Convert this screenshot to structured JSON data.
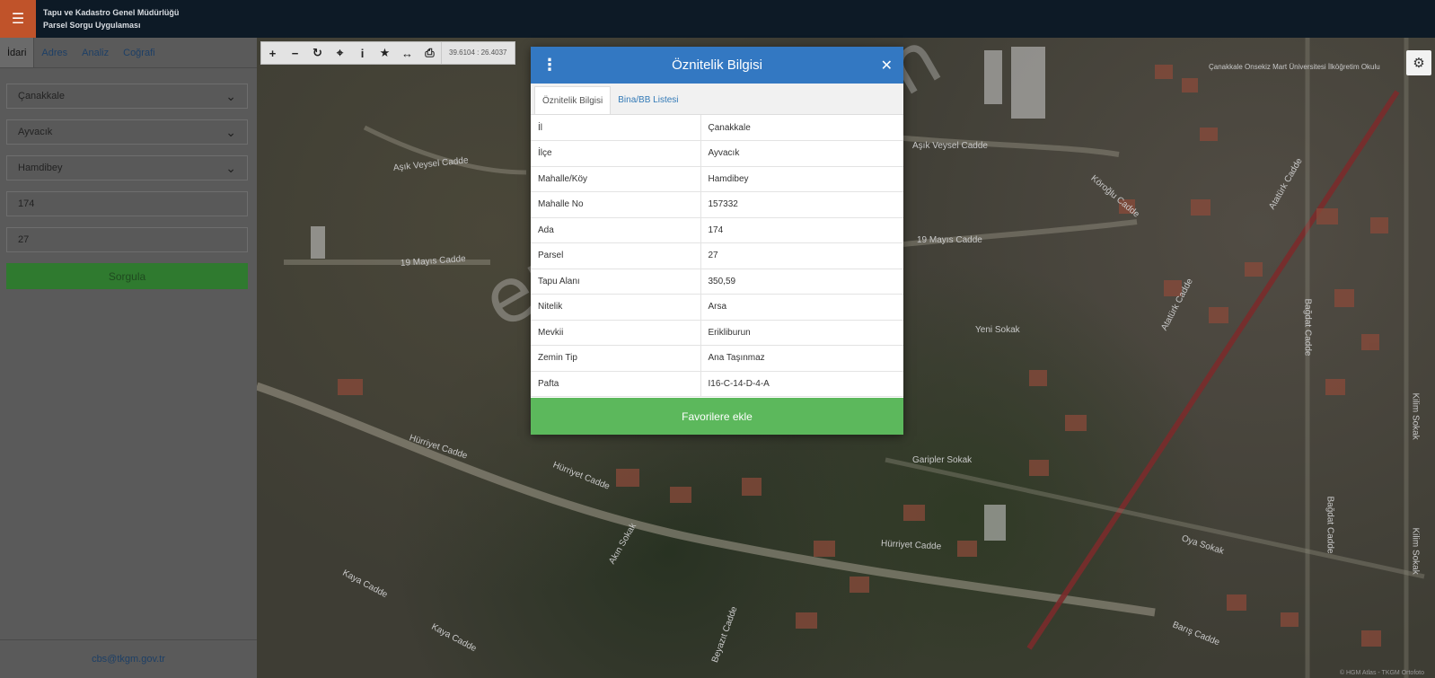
{
  "header": {
    "title_line1": "Tapu ve Kadastro Genel Müdürlüğü",
    "title_line2": "Parsel Sorgu Uygulaması",
    "menu_icon": "hamburger-icon"
  },
  "sidebar": {
    "tabs": [
      {
        "label": "İdari",
        "active": true
      },
      {
        "label": "Adres",
        "active": false
      },
      {
        "label": "Analiz",
        "active": false
      },
      {
        "label": "Coğrafi",
        "active": false
      }
    ],
    "province": "Çanakkale",
    "district": "Ayvacık",
    "neighborhood": "Hamdibey",
    "block": "174",
    "parcel": "27",
    "query_button": "Sorgula",
    "footer_email": "cbs@tkgm.gov.tr"
  },
  "toolbar": {
    "buttons": [
      "zoom-in-icon",
      "zoom-out-icon",
      "refresh-icon",
      "locate-icon",
      "info-icon",
      "star-icon",
      "measure-icon",
      "print-icon"
    ],
    "coords": "39.6104 : 26.4037"
  },
  "map": {
    "streets": [
      "Aşık Veysel Cadde",
      "19 Mayıs Cadde",
      "Hürriyet Cadde",
      "Hürriyet Cadde",
      "Kaya Cadde",
      "Kaya Cadde",
      "Akın Sokak",
      "Beyazıt Cadde",
      "Hürriyet Cadde",
      "Garipler Sokak",
      "Yeni Sokak",
      "Aşık Veysel Cadde",
      "Köroğlu Cadde",
      "19 Mayıs Cadde",
      "Atatürk Cadde",
      "Atatürk Cadde",
      "Bağdat Cadde",
      "Bağdat Cadde",
      "Oya Sokak",
      "Barış Cadde",
      "Kilim Sokak",
      "Kilim Sokak",
      "Çanakkale Onsekiz Mart Üniversitesi İlköğretim Okulu"
    ],
    "attribution": "© HGM Atlas - TKGM Ortofoto"
  },
  "dialog": {
    "title": "Öznitelik Bilgisi",
    "tabs": [
      {
        "label": "Öznitelik Bilgisi",
        "active": true
      },
      {
        "label": "Bina/BB Listesi",
        "active": false
      }
    ],
    "rows": [
      {
        "key": "İl",
        "value": "Çanakkale"
      },
      {
        "key": "İlçe",
        "value": "Ayvacık"
      },
      {
        "key": "Mahalle/Köy",
        "value": "Hamdibey"
      },
      {
        "key": "Mahalle No",
        "value": "157332"
      },
      {
        "key": "Ada",
        "value": "174"
      },
      {
        "key": "Parsel",
        "value": "27"
      },
      {
        "key": "Tapu Alanı",
        "value": "350,59"
      },
      {
        "key": "Nitelik",
        "value": "Arsa"
      },
      {
        "key": "Mevkii",
        "value": "Erikliburun"
      },
      {
        "key": "Zemin Tip",
        "value": "Ana Taşınmaz"
      },
      {
        "key": "Pafta",
        "value": "I16-C-14-D-4-A"
      }
    ],
    "favorite_button": "Favorilere ekle"
  },
  "watermark": "emlakjet.com",
  "colors": {
    "header_bg": "#0d1a26",
    "menu_accent": "#c0532a",
    "dialog_header": "#3378c2",
    "favorite_green": "#5cb85c",
    "query_green": "#2f7a2f"
  }
}
